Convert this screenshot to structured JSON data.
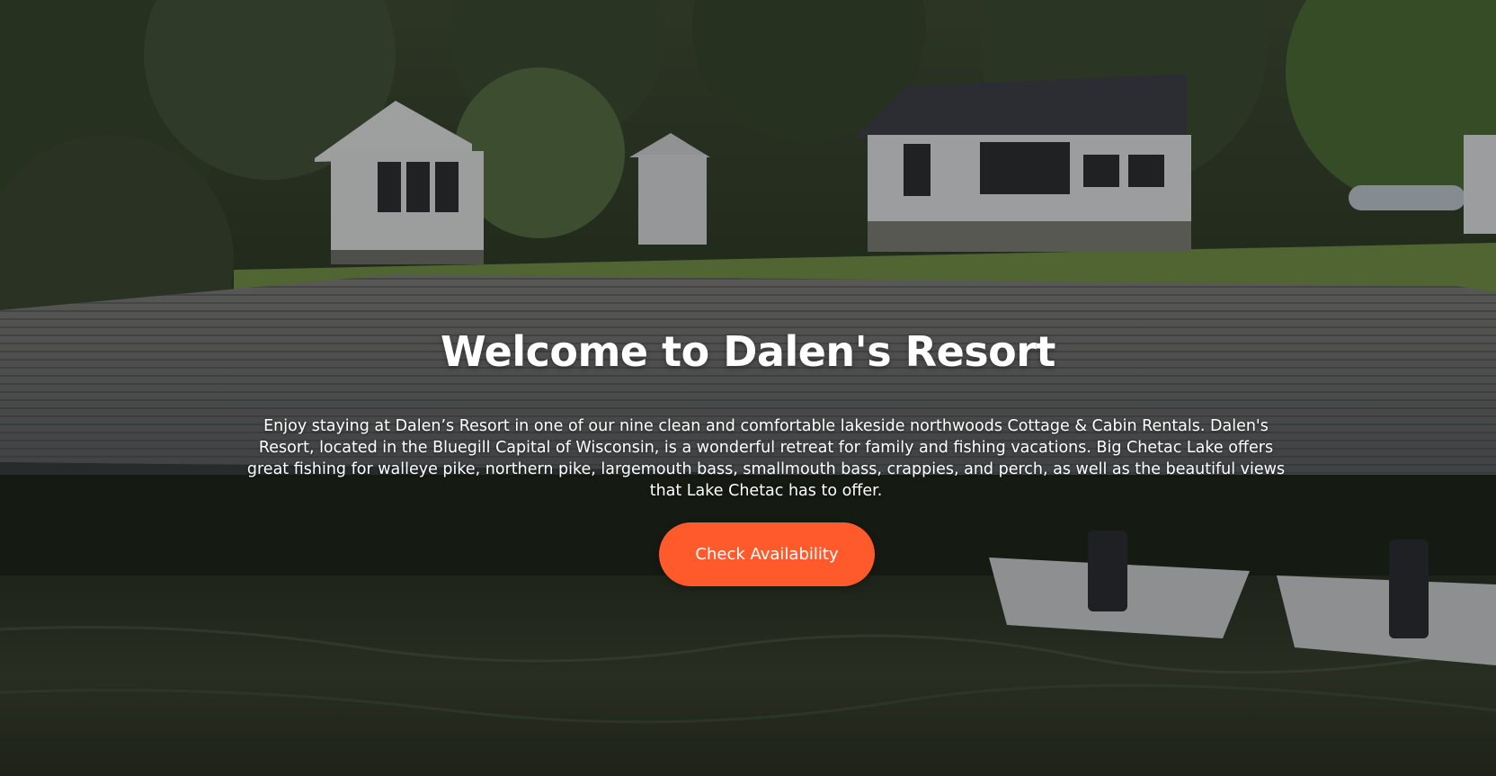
{
  "hero": {
    "title": "Welcome to Dalen's Resort",
    "description": "Enjoy staying at Dalen’s Resort in one of our nine clean and comfortable lakeside northwoods Cottage & Cabin Rentals. Dalen's Resort, located in the Bluegill Capital of Wisconsin, is a wonderful retreat for family and fishing vacations. Big Chetac Lake offers great fishing for walleye pike, northern pike, largemouth bass, smallmouth bass, crappies, and perch, as well as the beautiful views that Lake Chetac has to offer.",
    "cta_label": "Check Availability",
    "background_image": "lakeside-cabins-dock-photo"
  },
  "colors": {
    "cta_background": "#ff5a2b",
    "text": "#ffffff"
  }
}
